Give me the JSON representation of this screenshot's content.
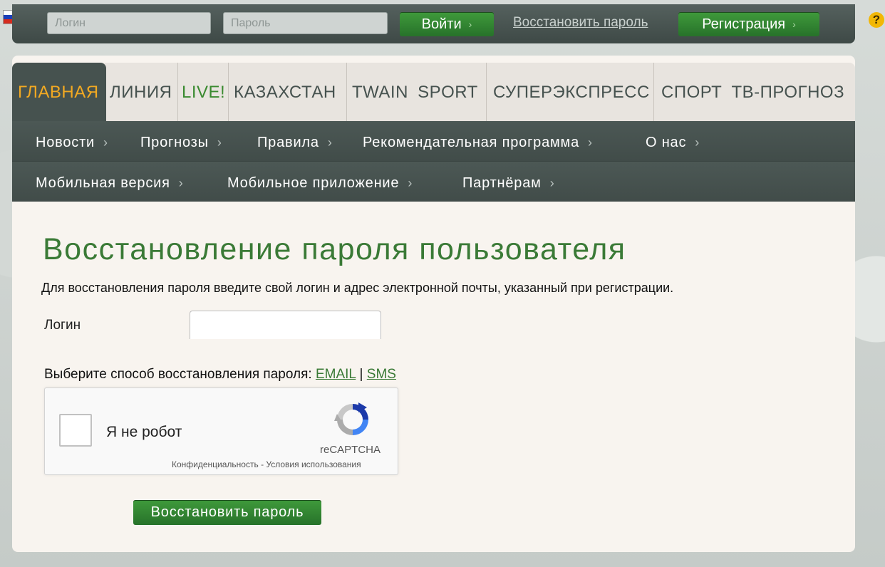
{
  "topbar": {
    "login_placeholder": "Логин",
    "password_placeholder": "Пароль",
    "login_button": "Войти",
    "recover_link": "Восстановить пароль",
    "register_button": "Регистрация",
    "help": "?"
  },
  "main_nav": [
    "ГЛАВНАЯ",
    "ЛИНИЯ",
    "LIVE!",
    "КАЗАХСТАН",
    "TWAIN SPORT",
    "СУПЕРЭКСПРЕСС",
    "СПОРТ ТВ-ПРОГНОЗ"
  ],
  "sub_nav_row1": [
    "Новости",
    "Прогнозы",
    "Правила",
    "Рекомендательная программа",
    "О нас"
  ],
  "sub_nav_row2": [
    "Мобильная версия",
    "Мобильное приложение",
    "Партнёрам"
  ],
  "chevron": "›",
  "page": {
    "title": "Восстановление пароля пользователя",
    "description": "Для восстановления пароля введите свой логин и адрес электронной почты, указанный при регистрации.",
    "login_label": "Логин",
    "method_prompt": "Выберите способ восстановления пароля:",
    "method_email": "EMAIL",
    "method_separator": "|",
    "method_sms": "SMS",
    "submit": "Восстановить пароль"
  },
  "captcha": {
    "label": "Я не робот",
    "brand": "reCAPTCHA",
    "privacy": "Конфиденциальность",
    "dash": "-",
    "terms": "Условия использования"
  },
  "colors": {
    "accent_green": "#3a7a36",
    "active_tab_text": "#f2a922",
    "live_text": "#3a8a30",
    "nav_dark": "#46524f"
  }
}
